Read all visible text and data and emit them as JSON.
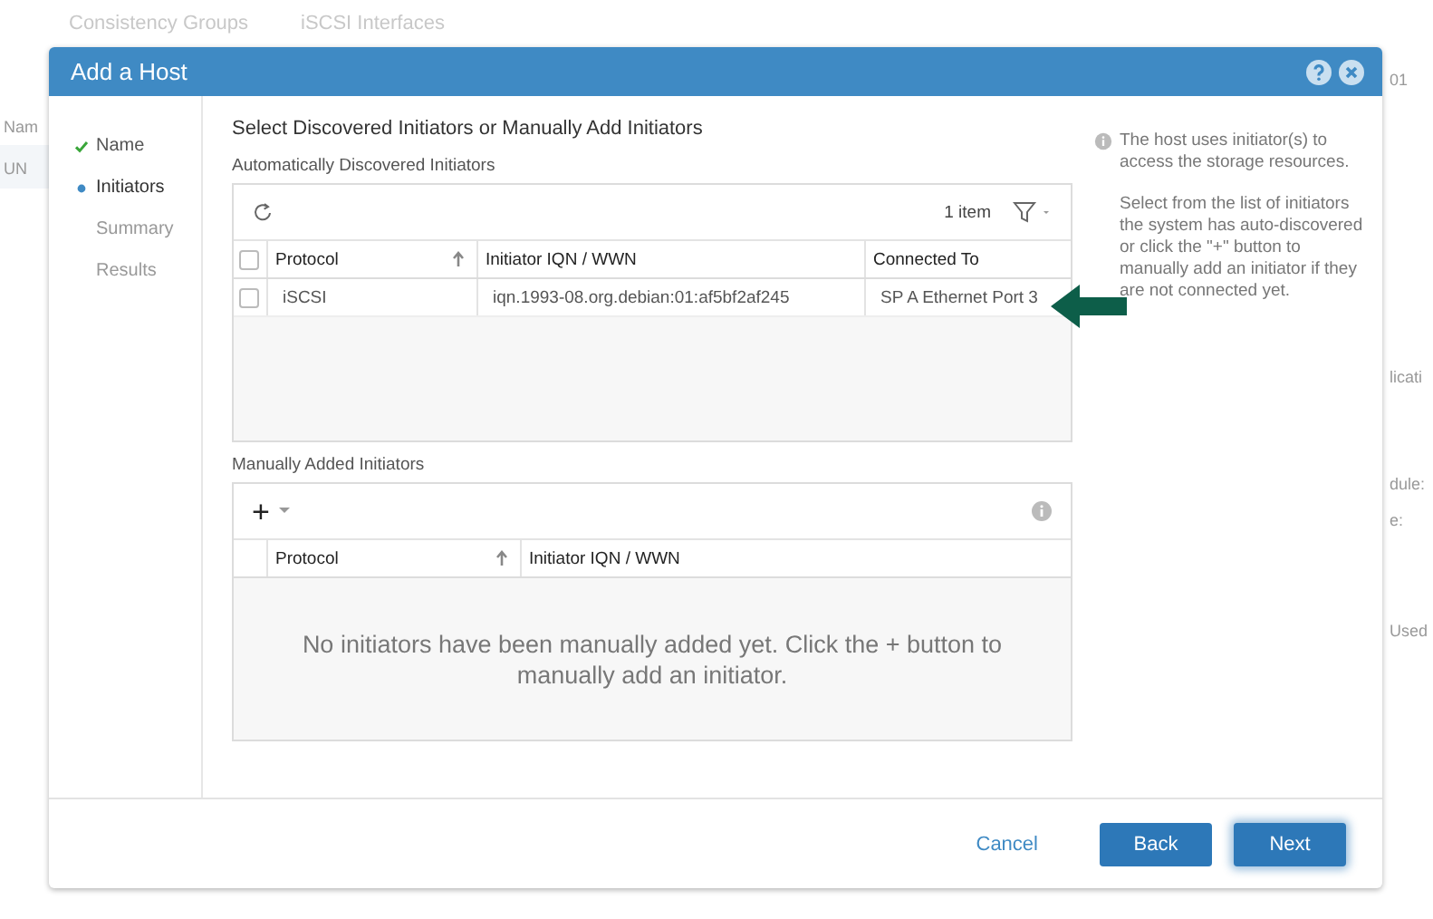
{
  "background": {
    "tabs": [
      "Consistency Groups",
      "iSCSI Interfaces"
    ],
    "fragments": [
      "Nam",
      "UN",
      "01",
      "licati",
      "dule:",
      "e:",
      "Used"
    ]
  },
  "dialog": {
    "title": "Add a Host",
    "steps": [
      {
        "label": "Name",
        "completed": true,
        "selected": false
      },
      {
        "label": "Initiators",
        "completed": false,
        "selected": true
      },
      {
        "label": "Summary",
        "completed": false,
        "selected": false
      },
      {
        "label": "Results",
        "completed": false,
        "selected": false
      }
    ],
    "heading": "Select Discovered Initiators or Manually Add Initiators",
    "discovered": {
      "label": "Automatically Discovered Initiators",
      "count": "1 item",
      "all_checked": false,
      "columns": [
        {
          "title": "Protocol",
          "sorted": true
        },
        {
          "title": "Initiator IQN / WWN",
          "sorted": false
        },
        {
          "title": "Connected To",
          "sorted": false
        }
      ],
      "rows": [
        {
          "checked": false,
          "cells": [
            "iSCSI",
            "iqn.1993-08.org.debian:01:af5bf2af245",
            "SP A Ethernet Port 3"
          ]
        }
      ]
    },
    "manual": {
      "label": "Manually Added Initiators",
      "add": "+",
      "columns": [
        {
          "title": "Protocol",
          "sorted": true
        },
        {
          "title": "Initiator IQN / WWN",
          "sorted": false
        }
      ],
      "empty": "No initiators have been manually added yet. Click the + button to manually add an initiator."
    },
    "help": [
      "The host uses initiator(s) to access the storage resources.",
      "Select from the list of initiators the system has auto-discovered or click the \"+\" button to manually add an initiator if they are not connected yet."
    ],
    "buttons": [
      {
        "label": "Cancel",
        "kind": "link"
      },
      {
        "label": "Back",
        "kind": "primary"
      },
      {
        "label": "Next",
        "kind": "focused"
      }
    ]
  }
}
